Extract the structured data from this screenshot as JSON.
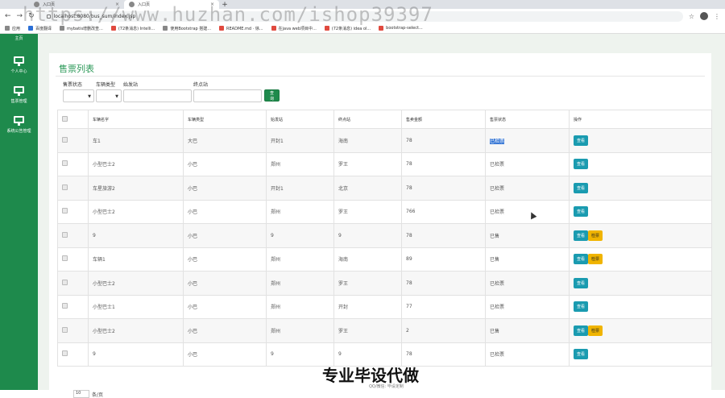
{
  "browser": {
    "tabs": [
      {
        "label": ""
      },
      {
        "label": "入口页"
      },
      {
        "label": "入口页"
      }
    ],
    "new_tab": "+",
    "url": "localhost:8080/bus_sum/index.jsp",
    "bookmarks": [
      "应用",
      "百度翻译",
      "mybatis增删改查...",
      "(72条消息) Intelli...",
      "使用Bootstrap 搭建...",
      "README.md · 徐...",
      "在java web项目中...",
      "(72条消息) idea ol...",
      "bootstrap-select..."
    ]
  },
  "watermark": "https://www.huzhan.com/ishop39397",
  "sidebar": {
    "top_label": "主页",
    "items": [
      {
        "label": "个人中心"
      },
      {
        "label": "售票管理"
      },
      {
        "label": "系统公告管理"
      }
    ]
  },
  "panel": {
    "title": "售票列表",
    "filters": {
      "status_label": "售票状态",
      "vehicle_type_label": "车辆类型",
      "start_label": "始发站",
      "end_label": "终点站",
      "query_button": "查询"
    }
  },
  "table": {
    "headers": [
      "",
      "车辆名字",
      "车辆类型",
      "始发站",
      "终点站",
      "售卖金额",
      "售票状态",
      "操作"
    ],
    "rows": [
      {
        "name": "车1",
        "type": "大巴",
        "start": "开封1",
        "end": "海南",
        "amount": "78",
        "status": "已检票",
        "actions": [
          "查看"
        ]
      },
      {
        "name": "小型巴士2",
        "type": "小巴",
        "start": "郑州",
        "end": "罗王",
        "amount": "78",
        "status": "已检票",
        "actions": [
          "查看"
        ]
      },
      {
        "name": "车星旅游2",
        "type": "小巴",
        "start": "开封1",
        "end": "北京",
        "amount": "78",
        "status": "已检票",
        "actions": [
          "查看"
        ]
      },
      {
        "name": "小型巴士2",
        "type": "小巴",
        "start": "郑州",
        "end": "罗王",
        "amount": "766",
        "status": "已检票",
        "actions": [
          "查看"
        ]
      },
      {
        "name": "9",
        "type": "小巴",
        "start": "9",
        "end": "9",
        "amount": "78",
        "status": "已售",
        "actions": [
          "查看",
          "检票"
        ]
      },
      {
        "name": "车辆1",
        "type": "小巴",
        "start": "郑州",
        "end": "海南",
        "amount": "89",
        "status": "已售",
        "actions": [
          "查看",
          "检票"
        ]
      },
      {
        "name": "小型巴士2",
        "type": "小巴",
        "start": "郑州",
        "end": "罗王",
        "amount": "78",
        "status": "已检票",
        "actions": [
          "查看"
        ]
      },
      {
        "name": "小型巴士1",
        "type": "小巴",
        "start": "郑州",
        "end": "开封",
        "amount": "77",
        "status": "已检票",
        "actions": [
          "查看"
        ]
      },
      {
        "name": "小型巴士2",
        "type": "小巴",
        "start": "郑州",
        "end": "罗王",
        "amount": "2",
        "status": "已售",
        "actions": [
          "查看",
          "检票"
        ]
      },
      {
        "name": "9",
        "type": "小巴",
        "start": "9",
        "end": "9",
        "amount": "78",
        "status": "已检票",
        "actions": [
          "查看"
        ]
      }
    ]
  },
  "pager": {
    "page_size": "10",
    "suffix": "条/页"
  },
  "overlay": {
    "title": "专业毕设代做",
    "sub": "QQ/微信: 毕设定制"
  }
}
